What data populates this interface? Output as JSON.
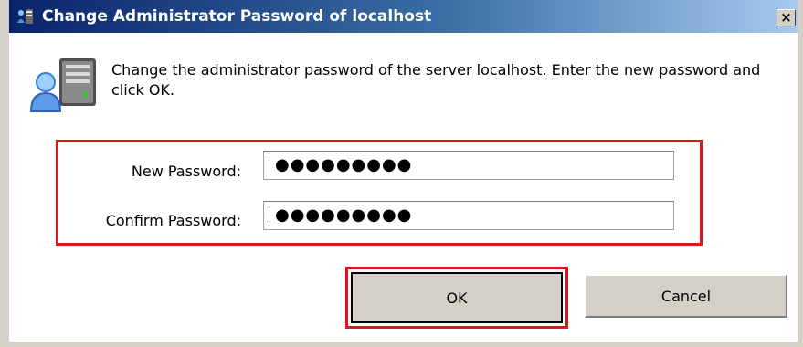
{
  "window": {
    "title": "Change Administrator Password of localhost",
    "close_glyph": "×"
  },
  "message": "Change the administrator password of the server localhost. Enter the new password and click OK.",
  "fields": {
    "new_password": {
      "label": "New Password:",
      "masked_value": "●●●●●●●●●"
    },
    "confirm_password": {
      "label": "Confirm Password:",
      "masked_value": "●●●●●●●●●"
    }
  },
  "buttons": {
    "ok": "OK",
    "cancel": "Cancel"
  },
  "icons": {
    "title": "server-users-icon",
    "header": "server-users-icon"
  },
  "colors": {
    "highlight": "#e0161d",
    "title_bar_start": "#0a246a",
    "dialog_face": "#d4d0c8"
  }
}
